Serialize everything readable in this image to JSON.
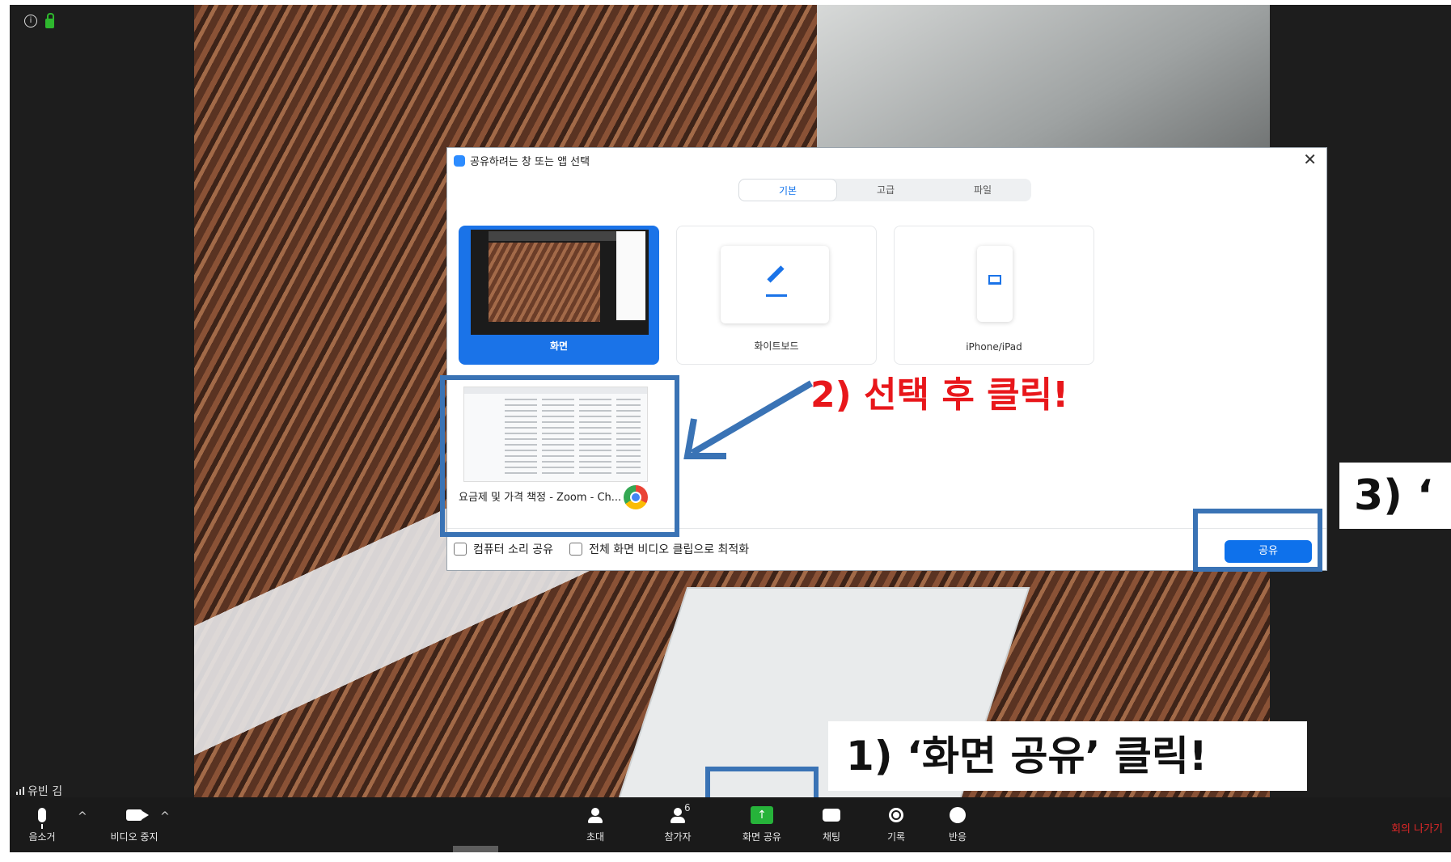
{
  "participant": {
    "name": "유빈 김"
  },
  "dialog": {
    "title": "공유하려는 창 또는 앱 선택",
    "close_glyph": "✕",
    "tabs": [
      {
        "label": "기본",
        "active": true
      },
      {
        "label": "고급",
        "active": false
      },
      {
        "label": "파일",
        "active": false
      }
    ],
    "tiles": [
      {
        "label": "화면",
        "selected": true
      },
      {
        "label": "화이트보드",
        "selected": false
      },
      {
        "label": "iPhone/iPad",
        "selected": false
      }
    ],
    "window_item": {
      "label": "요금제 및 가격 책정 - Zoom - Ch..."
    },
    "options": [
      {
        "label": "컴퓨터 소리 공유",
        "checked": false
      },
      {
        "label": "전체 화면 비디오 클립으로 최적화",
        "checked": false
      }
    ],
    "share_button": "공유"
  },
  "annotations": {
    "step1": "1) ‘화면 공유’  클릭!",
    "step2": "2) 선택 후 클릭!",
    "step3": "3) ‘"
  },
  "toolbar": {
    "mute": "음소거",
    "stop_video": "비디오 중지",
    "invite": "초대",
    "participants": "참가자",
    "participants_count": "6",
    "share_screen": "화면 공유",
    "chat": "채팅",
    "record": "기록",
    "reactions": "반응",
    "leave": "회의 나가기"
  },
  "colors": {
    "accent": "#0e71eb",
    "highlight_box": "#3a73b5",
    "annotation_red": "#e8171b",
    "share_green": "#26b33a",
    "leave_red": "#e02828"
  }
}
